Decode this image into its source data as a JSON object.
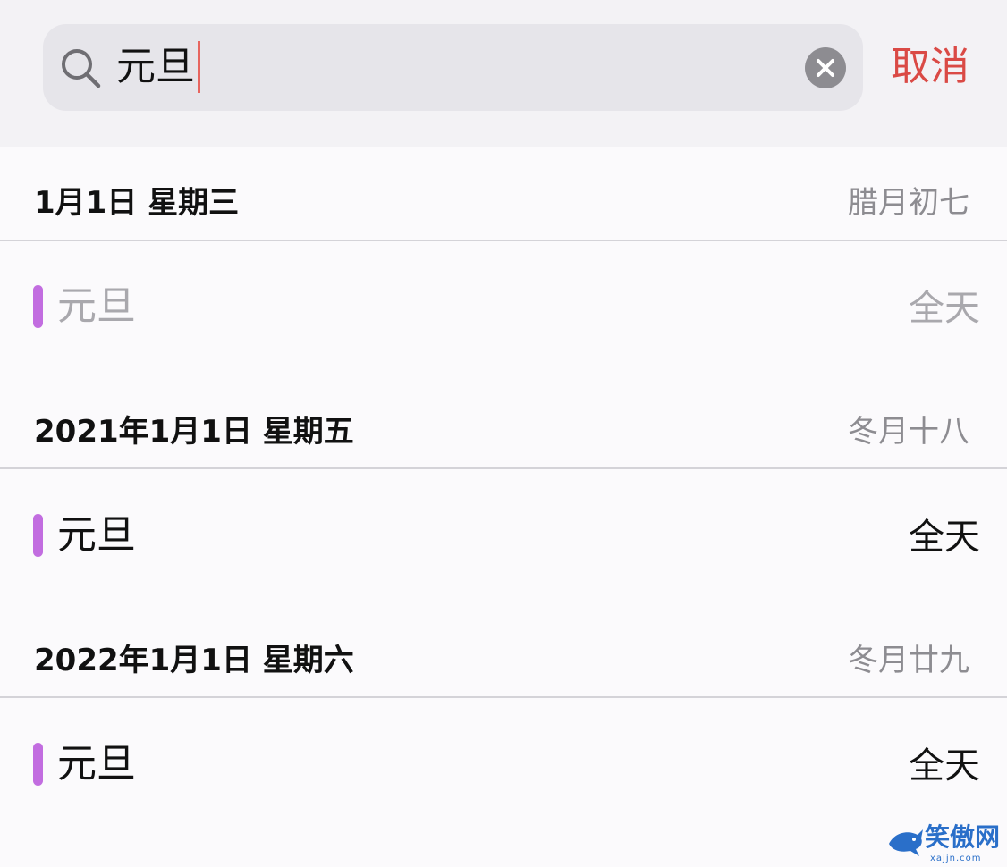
{
  "search": {
    "query": "元旦",
    "cancel_label": "取消",
    "icons": {
      "search": "search-icon",
      "clear": "clear-icon"
    }
  },
  "colors": {
    "accent": "#da4a45",
    "caret": "#e7655f",
    "event_color": "#c26de0"
  },
  "results": [
    {
      "date": "1月1日 星期三",
      "lunar": "腊月初七",
      "event": {
        "title": "元旦",
        "time": "全天",
        "dimmed": true
      }
    },
    {
      "date": "2021年1月1日 星期五",
      "lunar": "冬月十八",
      "event": {
        "title": "元旦",
        "time": "全天",
        "dimmed": false
      }
    },
    {
      "date": "2022年1月1日 星期六",
      "lunar": "冬月廿九",
      "event": {
        "title": "元旦",
        "time": "全天",
        "dimmed": false
      }
    }
  ],
  "watermark": {
    "text": "笑傲网",
    "url": "xajjn.com"
  }
}
